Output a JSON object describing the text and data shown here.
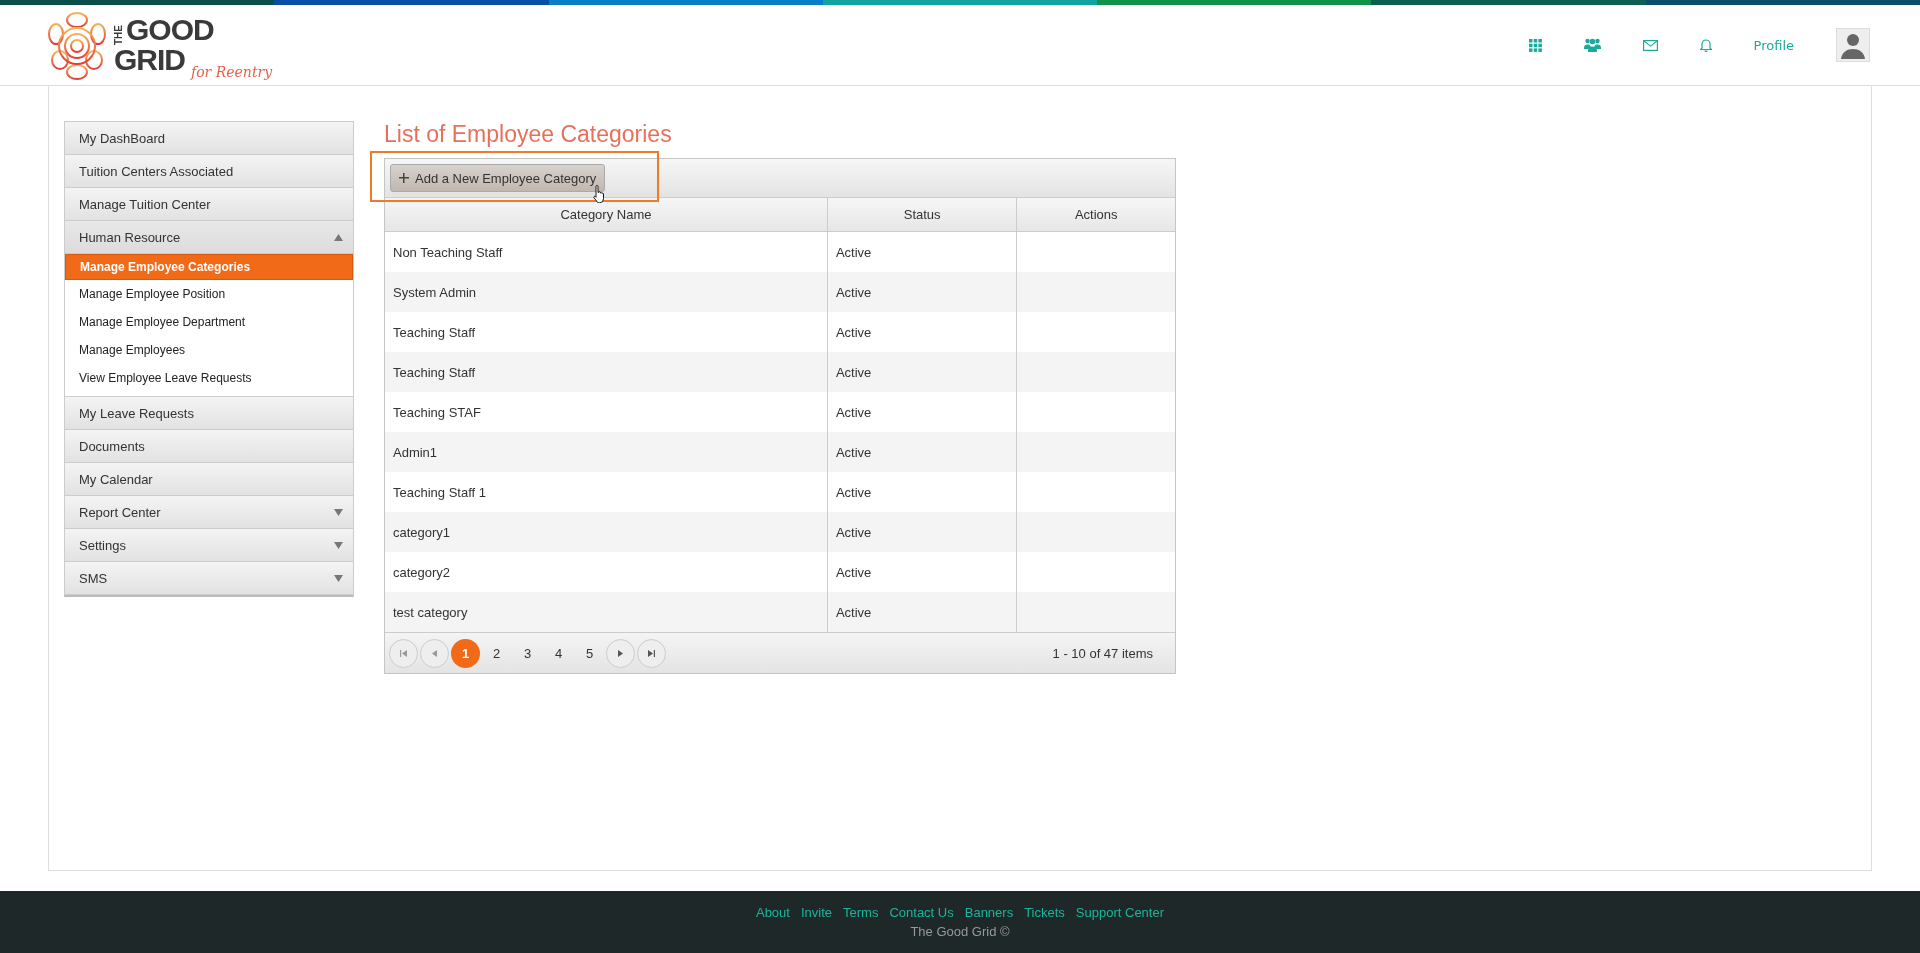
{
  "logo": {
    "word_1": "THE",
    "word_2": "GOOD",
    "word_3": "GRID",
    "tagline": "for Reentry"
  },
  "top_nav": {
    "profile_link": "Profile"
  },
  "sidebar": {
    "items": [
      {
        "label": "My DashBoard",
        "kind": "link"
      },
      {
        "label": "Tuition Centers Associated",
        "kind": "link"
      },
      {
        "label": "Manage Tuition Center",
        "kind": "link"
      },
      {
        "label": "Human Resource",
        "kind": "group",
        "expanded": true,
        "children": [
          {
            "label": "Manage Employee Categories",
            "selected": true
          },
          {
            "label": "Manage Employee Position",
            "selected": false
          },
          {
            "label": "Manage Employee Department",
            "selected": false
          },
          {
            "label": "Manage Employees",
            "selected": false
          },
          {
            "label": "View Employee Leave Requests",
            "selected": false
          }
        ]
      },
      {
        "label": "My Leave Requests",
        "kind": "link"
      },
      {
        "label": "Documents",
        "kind": "link"
      },
      {
        "label": "My Calendar",
        "kind": "link"
      },
      {
        "label": "Report Center",
        "kind": "group",
        "expanded": false
      },
      {
        "label": "Settings",
        "kind": "group",
        "expanded": false
      },
      {
        "label": "SMS",
        "kind": "group",
        "expanded": false
      }
    ]
  },
  "page_title": "List of Employee Categories",
  "add_button": {
    "label": "Add a New Employee Category"
  },
  "table": {
    "columns": [
      "Category Name",
      "Status",
      "Actions"
    ],
    "rows": [
      {
        "category_name": "Non Teaching Staff",
        "status": "Active"
      },
      {
        "category_name": "System Admin",
        "status": "Active"
      },
      {
        "category_name": "Teaching Staff",
        "status": "Active"
      },
      {
        "category_name": "Teaching Staff",
        "status": "Active"
      },
      {
        "category_name": "Teaching STAF",
        "status": "Active"
      },
      {
        "category_name": "Admin1",
        "status": "Active"
      },
      {
        "category_name": "Teaching Staff 1",
        "status": "Active"
      },
      {
        "category_name": "category1",
        "status": "Active"
      },
      {
        "category_name": "category2",
        "status": "Active"
      },
      {
        "category_name": "test category",
        "status": "Active"
      }
    ]
  },
  "pager": {
    "pages": [
      {
        "label": "1",
        "selected": true
      },
      {
        "label": "2",
        "selected": false
      },
      {
        "label": "3",
        "selected": false
      },
      {
        "label": "4",
        "selected": false
      },
      {
        "label": "5",
        "selected": false
      }
    ],
    "summary": "1 - 10 of 47 items"
  },
  "footer": {
    "links": [
      "About",
      "Invite",
      "Terms",
      "Contact Us",
      "Banners",
      "Tickets",
      "Support Center"
    ],
    "copyright": "The Good Grid ©"
  }
}
